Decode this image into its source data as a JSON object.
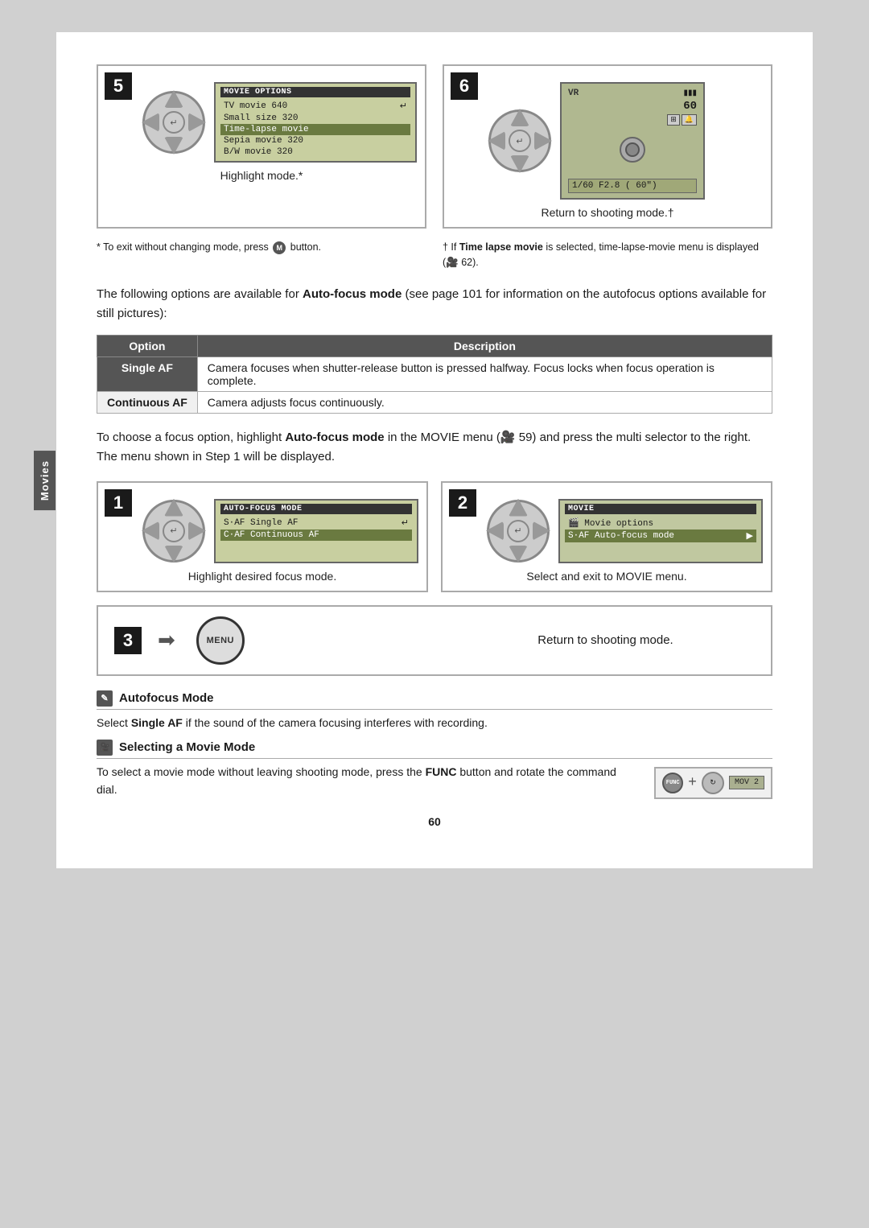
{
  "page": {
    "number": "60",
    "side_tab": "Movies"
  },
  "step5": {
    "number": "5",
    "caption": "Highlight mode.*",
    "lcd_title": "MOVIE OPTIONS",
    "items": [
      {
        "text": "TV movie 640",
        "state": "normal",
        "icon": "↵"
      },
      {
        "text": "Small size 320",
        "state": "normal"
      },
      {
        "text": "Time-lapse movie",
        "state": "highlighted"
      },
      {
        "text": "Sepia movie 320",
        "state": "normal"
      },
      {
        "text": "B/W movie 320",
        "state": "normal"
      }
    ]
  },
  "step6": {
    "number": "6",
    "caption": "Return to shooting mode.†",
    "vr_label": "VR",
    "shooting_info": "1/60  F2.8  ( 60\")",
    "battery_icon": "▮▮▮",
    "counter": "60"
  },
  "footnote1": {
    "symbol": "*",
    "text": "To exit without changing mode, press",
    "button_label": "MENU",
    "text2": "button."
  },
  "footnote2": {
    "symbol": "†",
    "text_pre": "If ",
    "bold_text": "Time lapse movie",
    "text_post": " is selected, time-lapse-movie menu is displayed (",
    "icon": "🎥",
    "page_ref": "62)."
  },
  "desc_paragraph": "The following options are available for ",
  "desc_bold": "Auto-focus mode",
  "desc_post": " (see page 101 for information on the autofocus options available for still pictures):",
  "table": {
    "col1_header": "Option",
    "col2_header": "Description",
    "rows": [
      {
        "option": "Single AF",
        "description": "Camera focuses when shutter-release button is pressed halfway.  Focus locks when focus operation is complete."
      },
      {
        "option": "Continuous AF",
        "description": "Camera adjusts focus continuously."
      }
    ]
  },
  "focus_text_pre": "To choose a focus option, highlight ",
  "focus_bold": "Auto-focus mode",
  "focus_text_post": " in the MOVIE menu (🎥 59) and press the multi selector to the right.  The menu shown in Step 1 will be displayed.",
  "step1": {
    "number": "1",
    "caption": "Highlight desired focus mode.",
    "lcd_title": "AUTO-FOCUS MODE",
    "items": [
      {
        "text": "S·AF Single AF",
        "state": "normal",
        "icon": "↵"
      },
      {
        "text": "C·AF Continuous AF",
        "state": "highlighted"
      }
    ]
  },
  "step2": {
    "number": "2",
    "caption": "Select and exit to MOVIE menu.",
    "lcd_title": "MOVIE",
    "items": [
      {
        "text": "Movie options",
        "state": "normal",
        "prefix": "🎬"
      },
      {
        "text": "Auto-focus mode",
        "state": "highlighted",
        "prefix": "S·AF",
        "arrow": "▶"
      }
    ]
  },
  "step3": {
    "number": "3",
    "caption": "Return to shooting mode.",
    "menu_label": "MENU"
  },
  "tip_autofocus": {
    "icon": "✎",
    "title": "Autofocus Mode",
    "text_pre": "Select ",
    "bold": "Single AF",
    "text_post": " if the sound of the camera focusing interferes with recording."
  },
  "tip_selecting": {
    "icon": "🎥",
    "title": "Selecting a Movie Mode",
    "text_pre": "To select a movie mode without leaving shooting mode, press the ",
    "bold": "FUNC",
    "text_post": " button and rotate the command dial."
  },
  "bottom_image": {
    "mode_display": "MOV 2",
    "func_label": "FUNC"
  }
}
